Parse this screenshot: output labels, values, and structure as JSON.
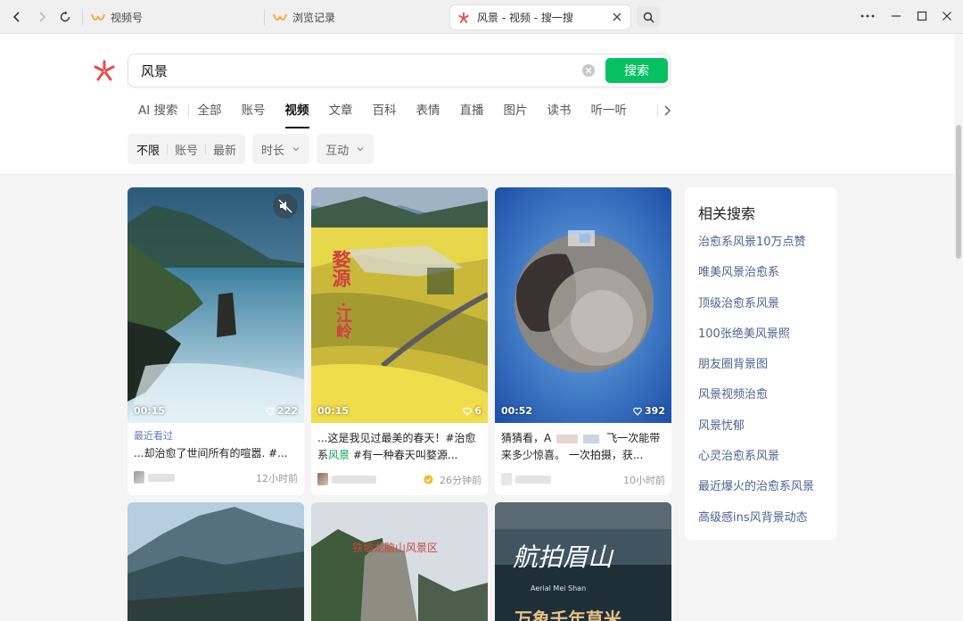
{
  "browser": {
    "tabs": [
      {
        "label": "视频号",
        "icon": "wechat-channels-icon",
        "active": false
      },
      {
        "label": "浏览记录",
        "icon": "wechat-channels-icon",
        "active": false
      },
      {
        "label": "风景 - 视频 - 搜一搜",
        "icon": "sousou-logo-icon",
        "active": true
      }
    ]
  },
  "search": {
    "query": "风景",
    "button_label": "搜索"
  },
  "type_tabs": [
    "AI 搜索",
    "全部",
    "账号",
    "视频",
    "文章",
    "百科",
    "表情",
    "直播",
    "图片",
    "读书",
    "听一听"
  ],
  "active_type_tab": "视频",
  "filters": {
    "group1": [
      "不限",
      "账号",
      "最新"
    ],
    "duration_label": "时长",
    "interaction_label": "互动"
  },
  "results": [
    {
      "duration": "00:15",
      "likes": "222",
      "recent_label": "最近看过",
      "desc": "...却治愈了世间所有的喧嚣. #...",
      "time": "12小时前"
    },
    {
      "duration": "00:15",
      "likes": "6",
      "desc_pre": "...这是我见过最美的春天！#治愈系",
      "desc_hl": "风景",
      "desc_post": " #有一种春天叫婺源...",
      "overlay_a": "婺源",
      "overlay_b": "·江岭",
      "time": "26分钟前"
    },
    {
      "duration": "00:52",
      "likes": "392",
      "desc_a": "猜猜看，A",
      "desc_b": "飞一次能带",
      "desc_c": "来多少惊喜。 一次拍摄，获...",
      "time": "10小时前"
    },
    {
      "overlay": ""
    },
    {
      "overlay": "铁坡龙脑山风景区"
    },
    {
      "overlay": "航拍眉山",
      "overlay_sub": "Aerial Mei Shan",
      "overlay_bottom": "万象千年草米"
    }
  ],
  "related": {
    "title": "相关搜索",
    "items": [
      "治愈系风景10万点赞",
      "唯美风景治愈系",
      "顶级治愈系风景",
      "100张绝美风景照",
      "朋友圈背景图",
      "风景视频治愈",
      "风景忧郁",
      "心灵治愈系风景",
      "最近爆火的治愈系风景",
      "高级感ins风背景动态"
    ]
  },
  "colors": {
    "accent": "#07c160",
    "link": "#4b6390",
    "recent": "#5b7bb6"
  }
}
